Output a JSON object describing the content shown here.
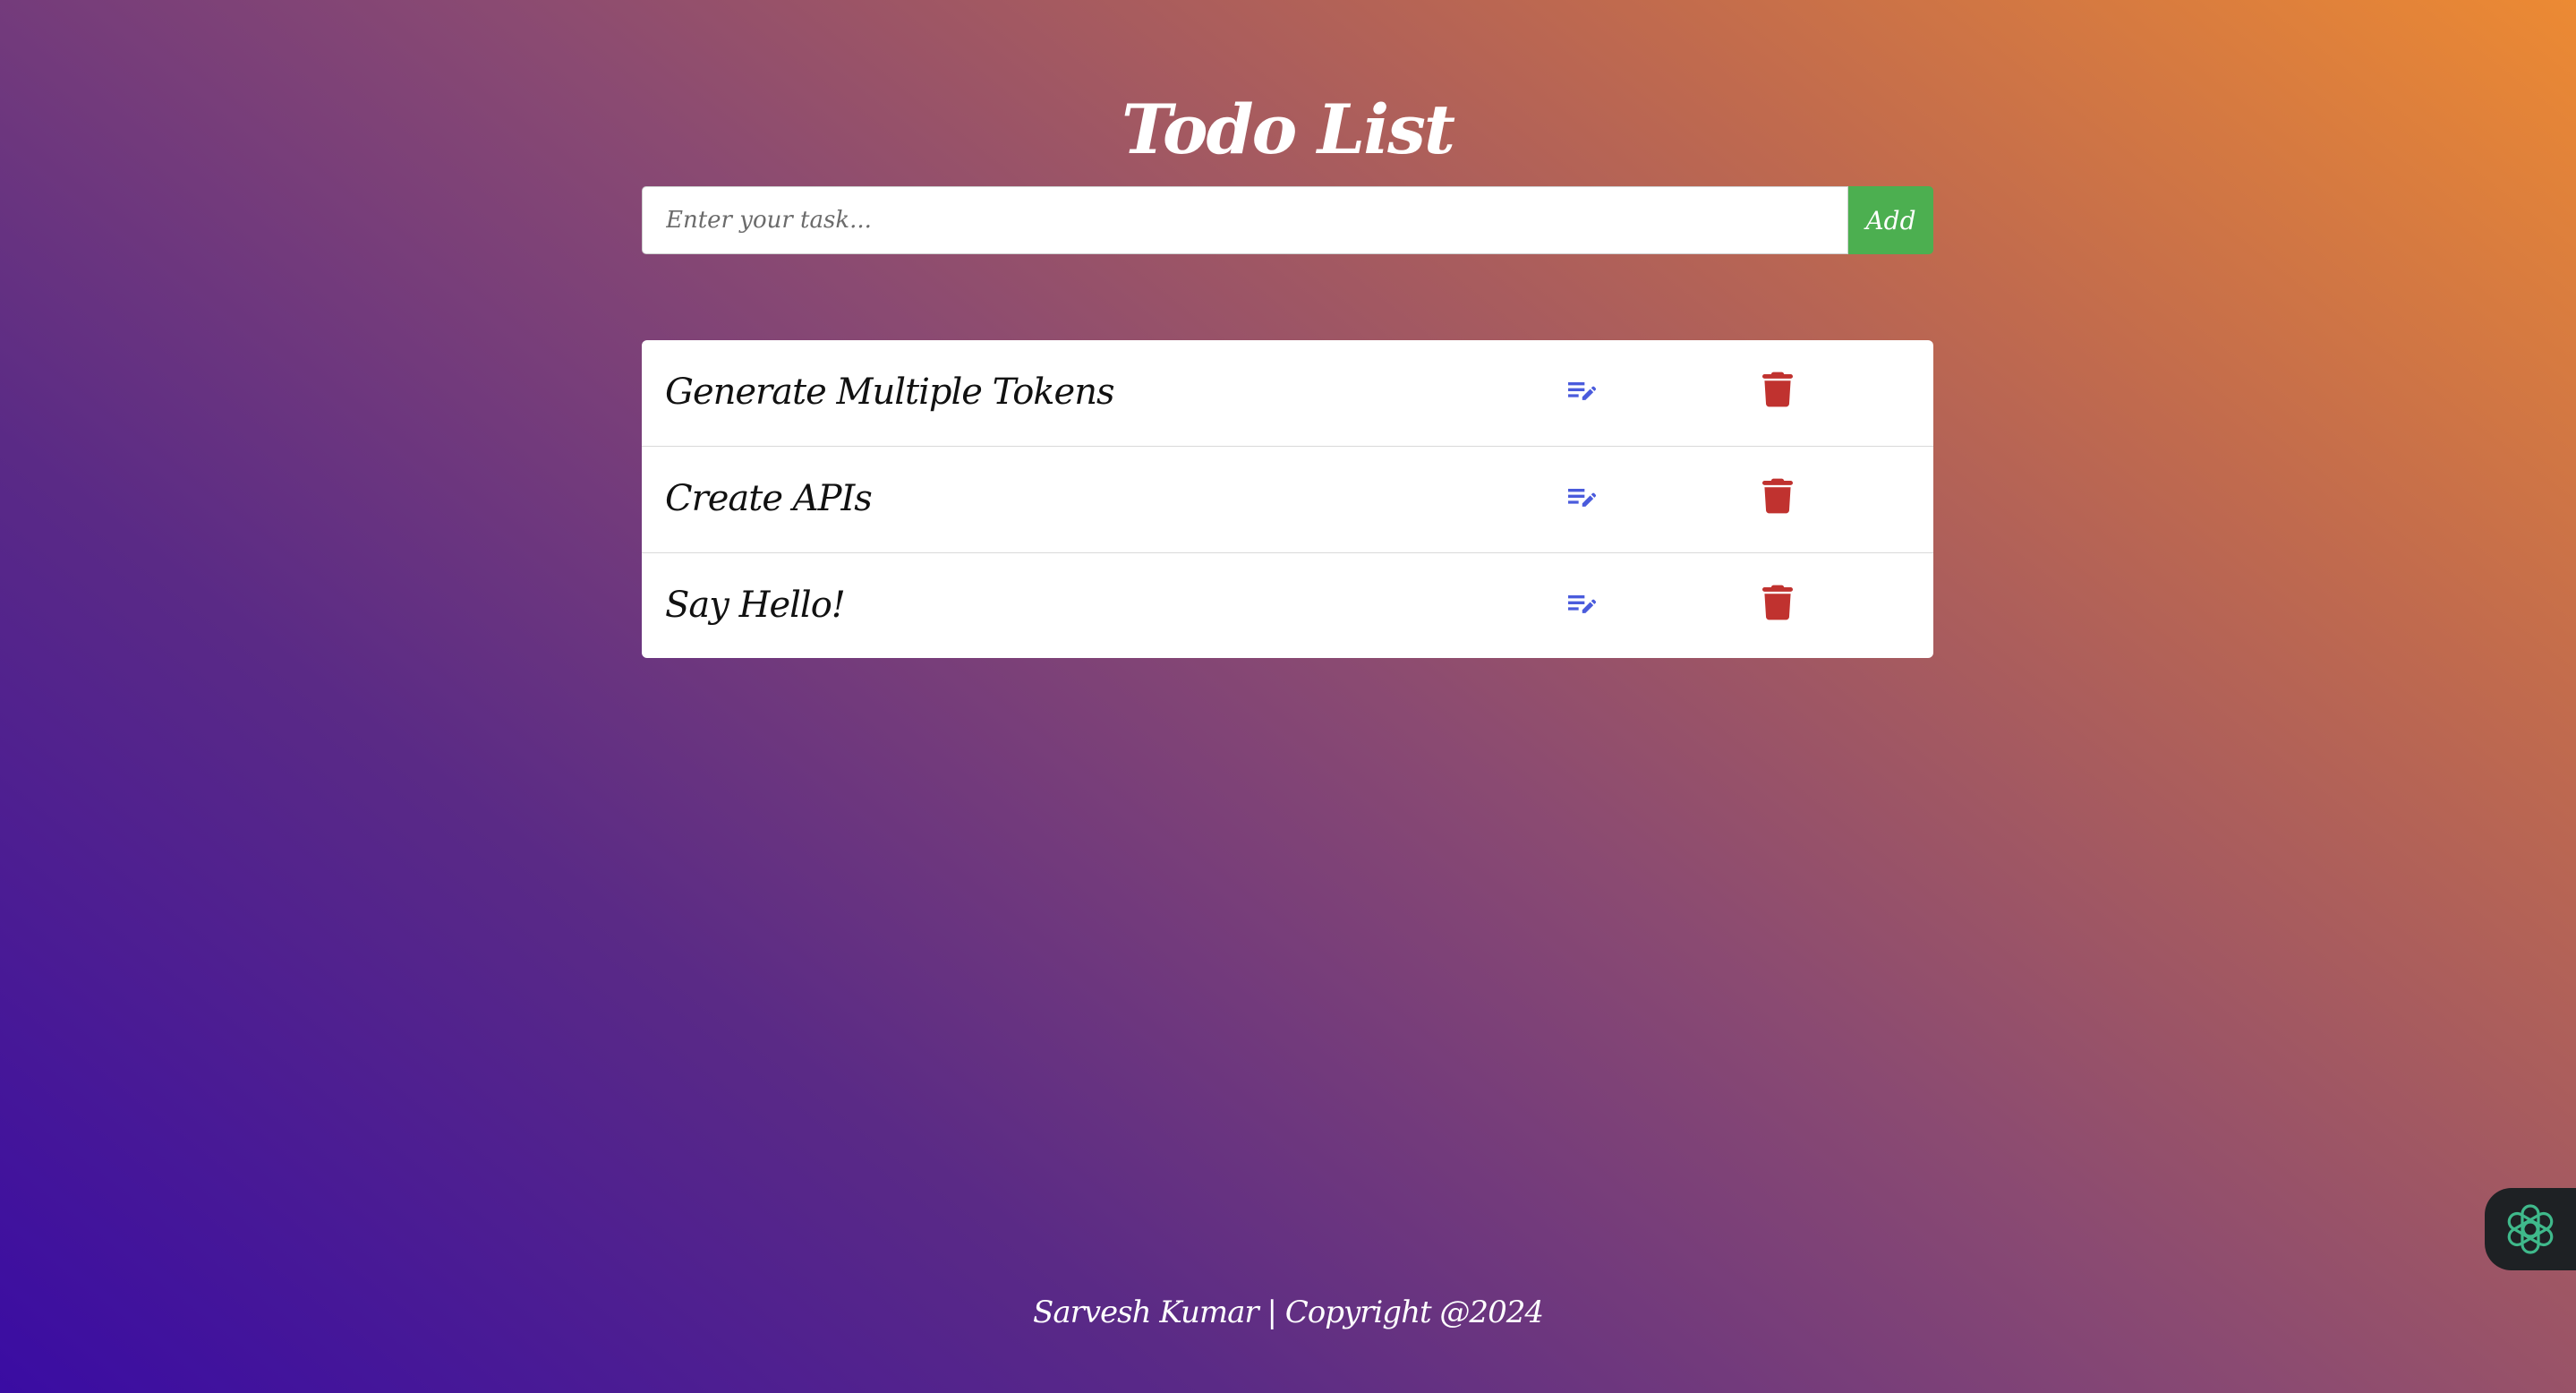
{
  "header": {
    "title": "Todo List"
  },
  "form": {
    "placeholder": "Enter your task...",
    "add_label": "Add"
  },
  "todos": [
    {
      "text": "Generate Multiple Tokens"
    },
    {
      "text": "Create APIs"
    },
    {
      "text": "Say Hello!"
    }
  ],
  "icons": {
    "edit": "edit-note-icon",
    "delete": "trash-icon",
    "assistant": "openai-icon"
  },
  "colors": {
    "add_button": "#4caf50",
    "edit_icon": "#4a5bdc",
    "delete_icon": "#c0322f",
    "widget_bg": "#1e2124",
    "widget_icon": "#3fb98b"
  },
  "footer": {
    "text": "Sarvesh Kumar | Copyright @2024"
  }
}
